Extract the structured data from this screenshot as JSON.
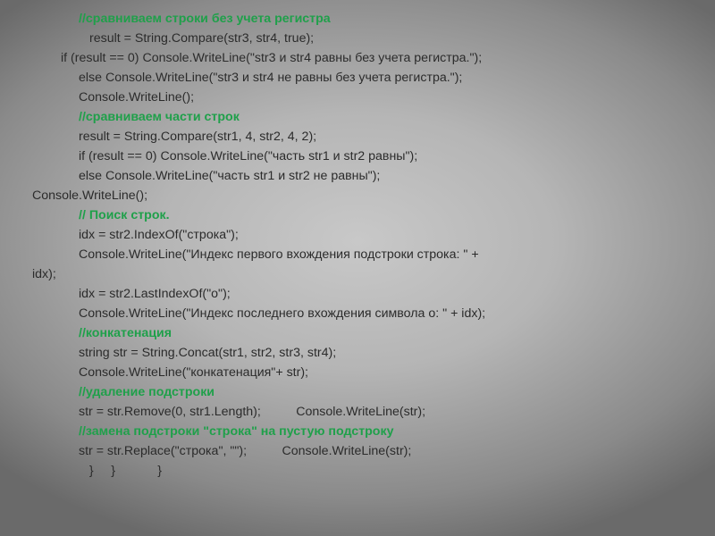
{
  "lines": [
    {
      "cls": "i2 comment",
      "text": "//сравниваем строки без учета регистра"
    },
    {
      "cls": "i3 code",
      "text": "result = String.Compare(str3, str4, true);"
    },
    {
      "cls": "i1 code",
      "text": "if (result == 0) Console.WriteLine(\"str3 и str4 равны без учета регистра.\");"
    },
    {
      "cls": "i2 code",
      "text": "else Console.WriteLine(\"str3 и str4 не равны без учета регистра.\");"
    },
    {
      "cls": "i2 code",
      "text": "Console.WriteLine();"
    },
    {
      "cls": "i2 comment",
      "text": "//сравниваем части строк"
    },
    {
      "cls": "i2 code",
      "text": "result = String.Compare(str1, 4, str2, 4, 2);"
    },
    {
      "cls": "i2 code",
      "text": "if (result == 0) Console.WriteLine(\"часть str1 и str2 равны\");"
    },
    {
      "cls": "i2 code",
      "text": "else Console.WriteLine(\"часть str1 и str2 не равны\");"
    },
    {
      "cls": "i0 code",
      "text": "Console.WriteLine();"
    },
    {
      "cls": "i2 comment",
      "text": "// Поиск строк."
    },
    {
      "cls": "i2 code",
      "text": "idx = str2.IndexOf(\"строка\");"
    },
    {
      "cls": "i2 code",
      "text": "Console.WriteLine(\"Индекс первого вхождения подстроки строка: \" + "
    },
    {
      "cls": "i0 code",
      "text": "idx);"
    },
    {
      "cls": "i2 code",
      "text": "idx = str2.LastIndexOf(\"о\");"
    },
    {
      "cls": "i2 code",
      "text": "Console.WriteLine(\"Индекс последнего вхождения символа о: \" + idx);"
    },
    {
      "cls": "i2 comment",
      "text": "//конкатенация"
    },
    {
      "cls": "i2 code",
      "text": "string str = String.Concat(str1, str2, str3, str4);"
    },
    {
      "cls": "i2 code",
      "text": "Console.WriteLine(\"конкатенация\"+ str);"
    },
    {
      "cls": "i2 comment",
      "text": "//удаление подстроки"
    },
    {
      "cls": "i2 code",
      "text": "str = str.Remove(0, str1.Length);          Console.WriteLine(str);"
    },
    {
      "cls": "i2 comment",
      "text": "//замена подстроки \"строка\" на пустую подстроку"
    },
    {
      "cls": "i2 code",
      "text": "str = str.Replace(\"строка\", \"\");          Console.WriteLine(str);"
    },
    {
      "cls": "i2 code",
      "text": "   }     }            }"
    }
  ]
}
